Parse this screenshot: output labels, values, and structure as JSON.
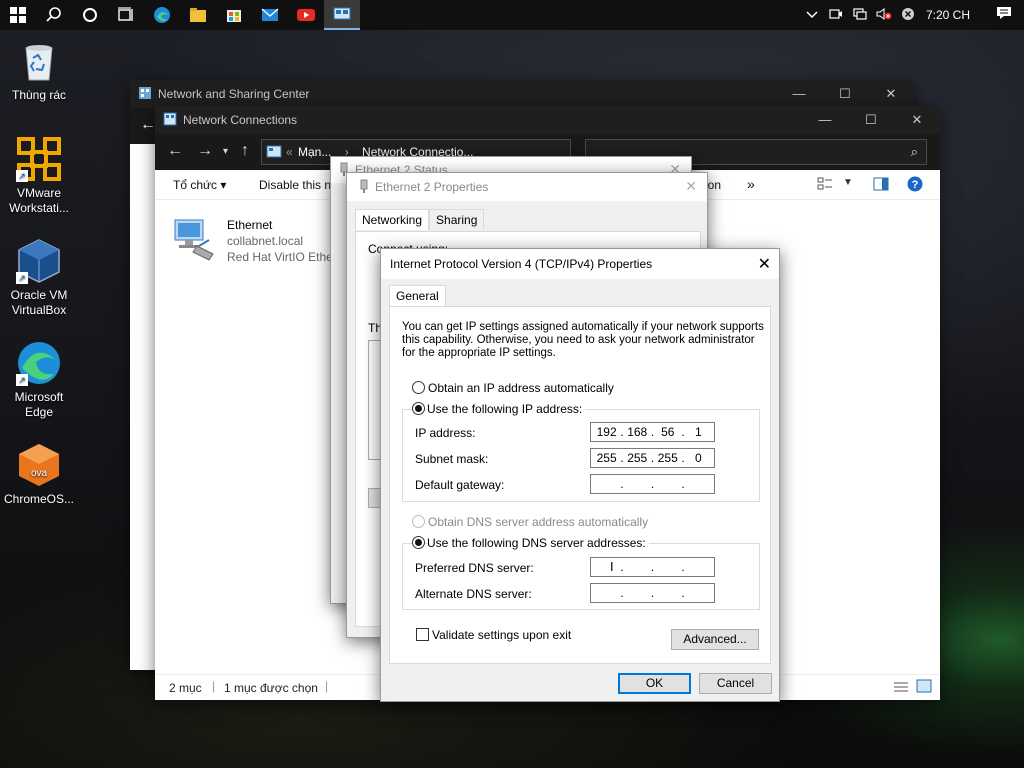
{
  "taskbar": {
    "icons": [
      "windows-start-icon",
      "search-icon",
      "cortana-icon",
      "task-view-icon",
      "edge-icon",
      "file-explorer-icon",
      "store-icon",
      "mail-icon",
      "youtube-icon",
      "network-connections-icon"
    ],
    "tray_icons": [
      "chevron-up-icon",
      "meet-now-icon",
      "network-icon",
      "volume-muted-icon",
      "close-circle-icon"
    ],
    "clock": "7:20 CH"
  },
  "desktop": {
    "icons": [
      {
        "label": "Thùng rác",
        "icon": "recycle-bin-icon"
      },
      {
        "label": "VMware Workstati...",
        "icon": "vmware-icon"
      },
      {
        "label": "Oracle VM VirtualBox",
        "icon": "virtualbox-icon"
      },
      {
        "label": "Microsoft Edge",
        "icon": "edge-icon"
      },
      {
        "label": "ChromeOS...",
        "icon": "ova-icon"
      }
    ]
  },
  "nsc_window": {
    "title": "Network and Sharing Center"
  },
  "nc_window": {
    "title": "Network Connections",
    "address": {
      "part1": "Mạn...",
      "sep": "›",
      "part2": "Network Connectio..."
    },
    "toolbar": {
      "organize": "Tổ chức",
      "disable": "Disable this n",
      "more_label": "ion"
    },
    "item": {
      "name": "Ethernet",
      "domain": "collabnet.local",
      "adapter": "Red Hat VirtIO Ether"
    },
    "status": {
      "count": "2 mục",
      "selected": "1 mục được chọn"
    }
  },
  "status_window": {
    "title": "Ethernet 2 Status"
  },
  "props_window": {
    "title": "Ethernet 2 Properties",
    "tabs": [
      "Networking",
      "Sharing"
    ],
    "connect_using": "Connect using:",
    "this_conn": "Th"
  },
  "ipv4": {
    "title": "Internet Protocol Version 4 (TCP/IPv4) Properties",
    "tab": "General",
    "description": [
      "You can get IP settings assigned automatically if your network supports",
      "this capability. Otherwise, you need to ask your network administrator",
      "for the appropriate IP settings."
    ],
    "obtain_ip_auto": "Obtain an IP address automatically",
    "use_following_ip": "Use the following IP address:",
    "ip_label": "IP address:",
    "ip_value": [
      "192",
      "168",
      "56",
      "1"
    ],
    "subnet_label": "Subnet mask:",
    "subnet_value": [
      "255",
      "255",
      "255",
      "0"
    ],
    "gateway_label": "Default gateway:",
    "obtain_dns_auto": "Obtain DNS server address automatically",
    "use_following_dns": "Use the following DNS server addresses:",
    "preferred_dns_label": "Preferred DNS server:",
    "alternate_dns_label": "Alternate DNS server:",
    "validate_label": "Validate settings upon exit",
    "advanced_label": "Advanced...",
    "ok_label": "OK",
    "cancel_label": "Cancel"
  }
}
